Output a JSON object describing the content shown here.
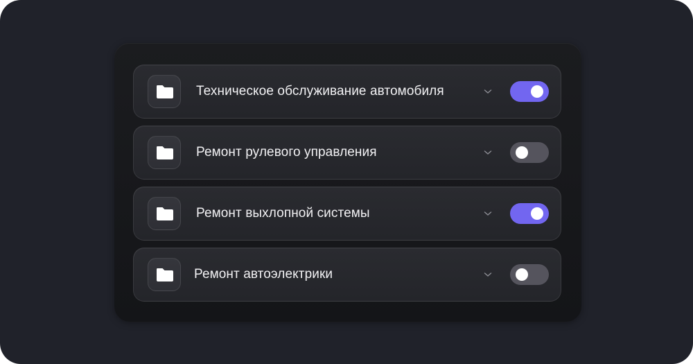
{
  "colors": {
    "background": "#20222a",
    "panel": "#17181b",
    "row": "#27282d",
    "toggle_on": "#7266f0",
    "toggle_off": "#55545d",
    "text": "#f2f2f4"
  },
  "services": [
    {
      "label": "Техническое обслуживание автомобиля",
      "icon": "folder-icon",
      "expand_icon": "chevron-down-icon",
      "enabled": true
    },
    {
      "label": "Ремонт рулевого управления",
      "icon": "folder-icon",
      "expand_icon": "chevron-down-icon",
      "enabled": false
    },
    {
      "label": "Ремонт выхлопной системы",
      "icon": "folder-icon",
      "expand_icon": "chevron-down-icon",
      "enabled": true
    },
    {
      "label": "Ремонт автоэлектрики",
      "icon": "folder-icon",
      "expand_icon": "chevron-down-icon",
      "enabled": false
    }
  ]
}
